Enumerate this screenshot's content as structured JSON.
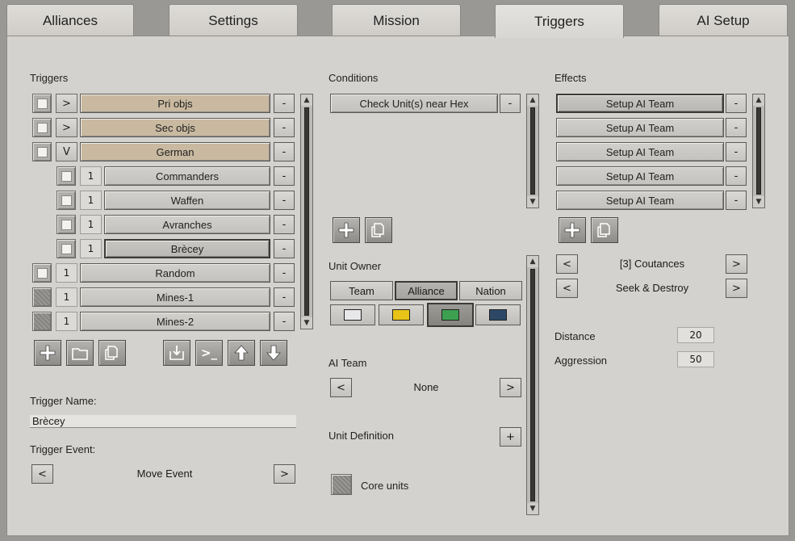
{
  "tabs": [
    {
      "label": "Alliances",
      "active": false
    },
    {
      "label": "Settings",
      "active": false
    },
    {
      "label": "Mission",
      "active": false
    },
    {
      "label": "Triggers",
      "active": true
    },
    {
      "label": "AI Setup",
      "active": false
    }
  ],
  "triggers_panel": {
    "title": "Triggers",
    "rows": [
      {
        "toggle": ">",
        "label": "Pri objs",
        "style": "tan",
        "checkbox": "light"
      },
      {
        "toggle": ">",
        "label": "Sec objs",
        "style": "tan",
        "checkbox": "light"
      },
      {
        "toggle": "V",
        "label": "German",
        "style": "tan",
        "checkbox": "light"
      },
      {
        "toggle": "1",
        "label": "Commanders",
        "style": "grey",
        "checkbox": "light"
      },
      {
        "toggle": "1",
        "label": "Waffen",
        "style": "grey",
        "checkbox": "light"
      },
      {
        "toggle": "1",
        "label": "Avranches",
        "style": "grey",
        "checkbox": "light"
      },
      {
        "toggle": "1",
        "label": "Brècey",
        "style": "sel",
        "checkbox": "light"
      },
      {
        "toggle": "1",
        "label": "Random",
        "style": "grey",
        "checkbox": "light"
      },
      {
        "toggle": "1",
        "label": "Mines-1",
        "style": "grey",
        "checkbox": "dark"
      },
      {
        "toggle": "1",
        "label": "Mines-2",
        "style": "grey",
        "checkbox": "dark"
      }
    ],
    "minus_label": "-",
    "toolbar": {
      "add_icon": "plus-icon",
      "folder_icon": "folder-icon",
      "copy_icon": "copy-icon",
      "import_icon": "import-icon",
      "console_icon": "console-icon",
      "up_icon": "arrow-up-icon",
      "down_icon": "arrow-down-icon",
      "console_text": ">_"
    },
    "trigger_name_label": "Trigger Name:",
    "trigger_name_value": "Brècey",
    "trigger_event_label": "Trigger Event:",
    "trigger_event_value": "Move Event",
    "prev": "<",
    "next": ">"
  },
  "conditions_panel": {
    "title": "Conditions",
    "items": [
      "Check Unit(s) near Hex"
    ],
    "minus_label": "-",
    "unit_owner_label": "Unit Owner",
    "owner_options": [
      {
        "label": "Team",
        "selected": false
      },
      {
        "label": "Alliance",
        "selected": true
      },
      {
        "label": "Nation",
        "selected": false
      }
    ],
    "swatches": [
      {
        "color": "#e8e8ea",
        "selected": false
      },
      {
        "color": "#e8c418",
        "selected": false
      },
      {
        "color": "#3ca050",
        "selected": true
      },
      {
        "color": "#2c4866",
        "selected": false
      }
    ],
    "ai_team_label": "AI Team",
    "ai_team_value": "None",
    "prev": "<",
    "next": ">",
    "unit_definition_label": "Unit Definition",
    "unit_definition_add": "+",
    "core_units_label": "Core units"
  },
  "effects_panel": {
    "title": "Effects",
    "items": [
      "Setup AI Team",
      "Setup AI Team",
      "Setup AI Team",
      "Setup AI Team",
      "Setup AI Team"
    ],
    "minus_label": "-",
    "location_value": "[3] Coutances",
    "order_value": "Seek & Destroy",
    "prev": "<",
    "next": ">",
    "distance_label": "Distance",
    "distance_value": "20",
    "aggression_label": "Aggression",
    "aggression_value": "50"
  }
}
